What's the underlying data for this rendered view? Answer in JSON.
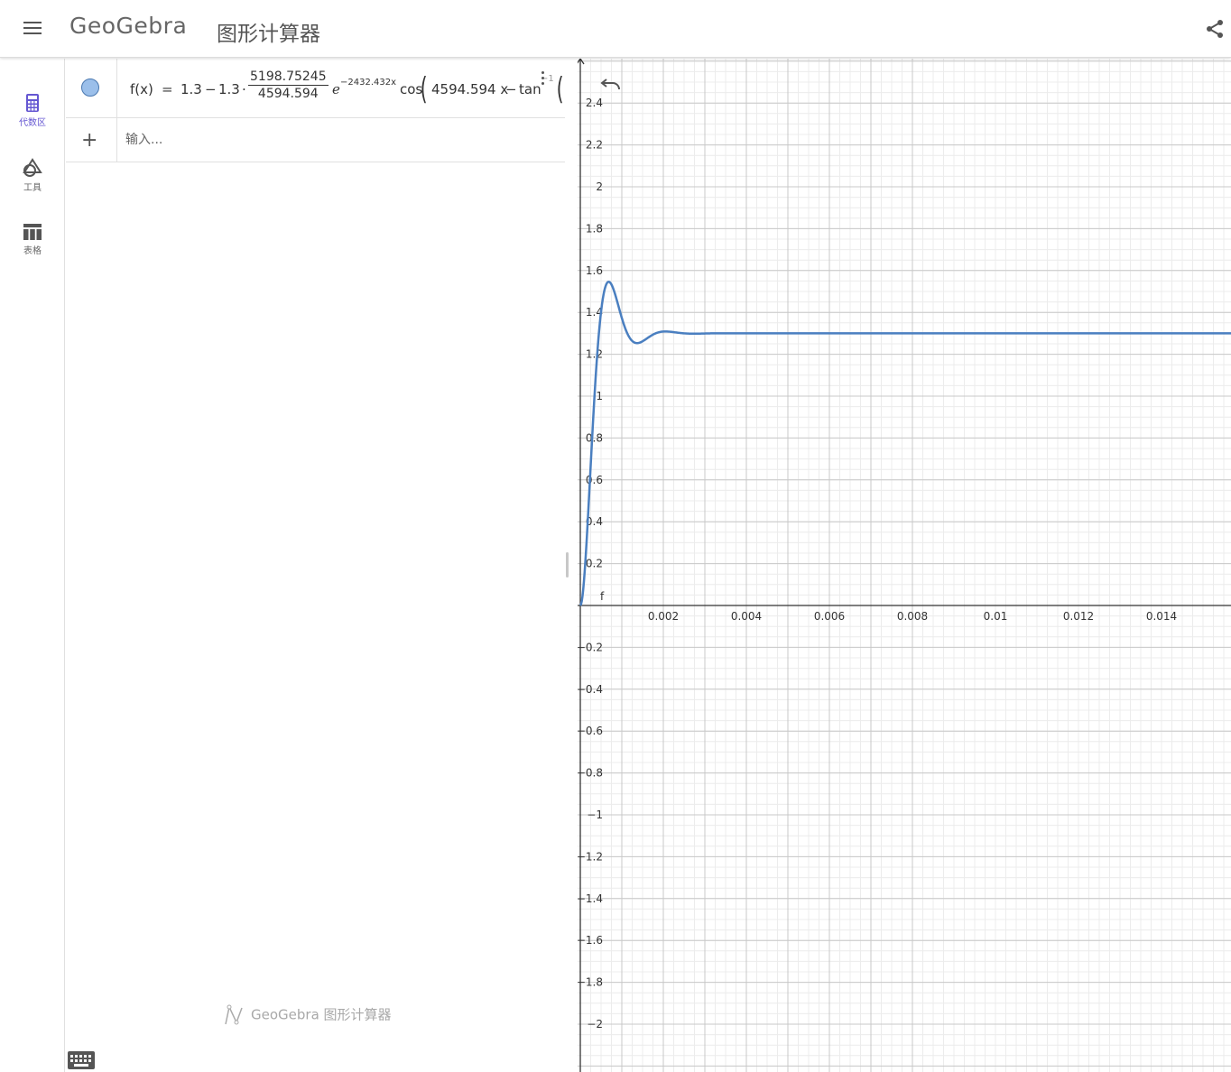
{
  "header": {
    "logo": "GeoGebra",
    "app_name": "图形计算器"
  },
  "rail": {
    "items": [
      {
        "label": "代数区",
        "icon": "calculator-icon",
        "active": true
      },
      {
        "label": "工具",
        "icon": "shapes-tools-icon",
        "active": false
      },
      {
        "label": "表格",
        "icon": "table-icon",
        "active": false
      }
    ]
  },
  "algebra": {
    "object": {
      "lhs": "f(x)",
      "eq": "=",
      "t1": "1.3",
      "minus1": "−",
      "t2": "1.3",
      "dot": "·",
      "frac_num": "5198.75245",
      "frac_den": "4594.594",
      "e": "e",
      "exp": "−2432.432x",
      "cos": "cos",
      "arg": "4594.594 x",
      "minus2": "−",
      "tan": "tan",
      "inv": "−1"
    },
    "input_placeholder": "输入...",
    "watermark": "GeoGebra 图形计算器"
  },
  "graphics": {
    "x_ticks": [
      "0.002",
      "0.004",
      "0.006",
      "0.008",
      "0.01",
      "0.012",
      "0.014"
    ],
    "y_ticks_pos": [
      "0.2",
      "0.4",
      "0.6",
      "0.8",
      "1",
      "1.2",
      "1.4",
      "1.6",
      "1.8",
      "2",
      "2.2",
      "2.4"
    ],
    "y_ticks_neg": [
      "−0.2",
      "−0.4",
      "−0.6",
      "−0.8",
      "−1",
      "−1.2",
      "−1.4",
      "−1.6",
      "−1.8",
      "−2"
    ],
    "function_label": "f",
    "curve_color": "#4a7fc0",
    "function": {
      "A": 1.3,
      "ratio": 1.13147,
      "alpha": 2432.432,
      "omega": 4594.594,
      "phi_tan": 0.5294
    },
    "view": {
      "x_min": 0,
      "x_max": 0.0157,
      "y_min": -2.2,
      "y_max": 2.6
    }
  }
}
